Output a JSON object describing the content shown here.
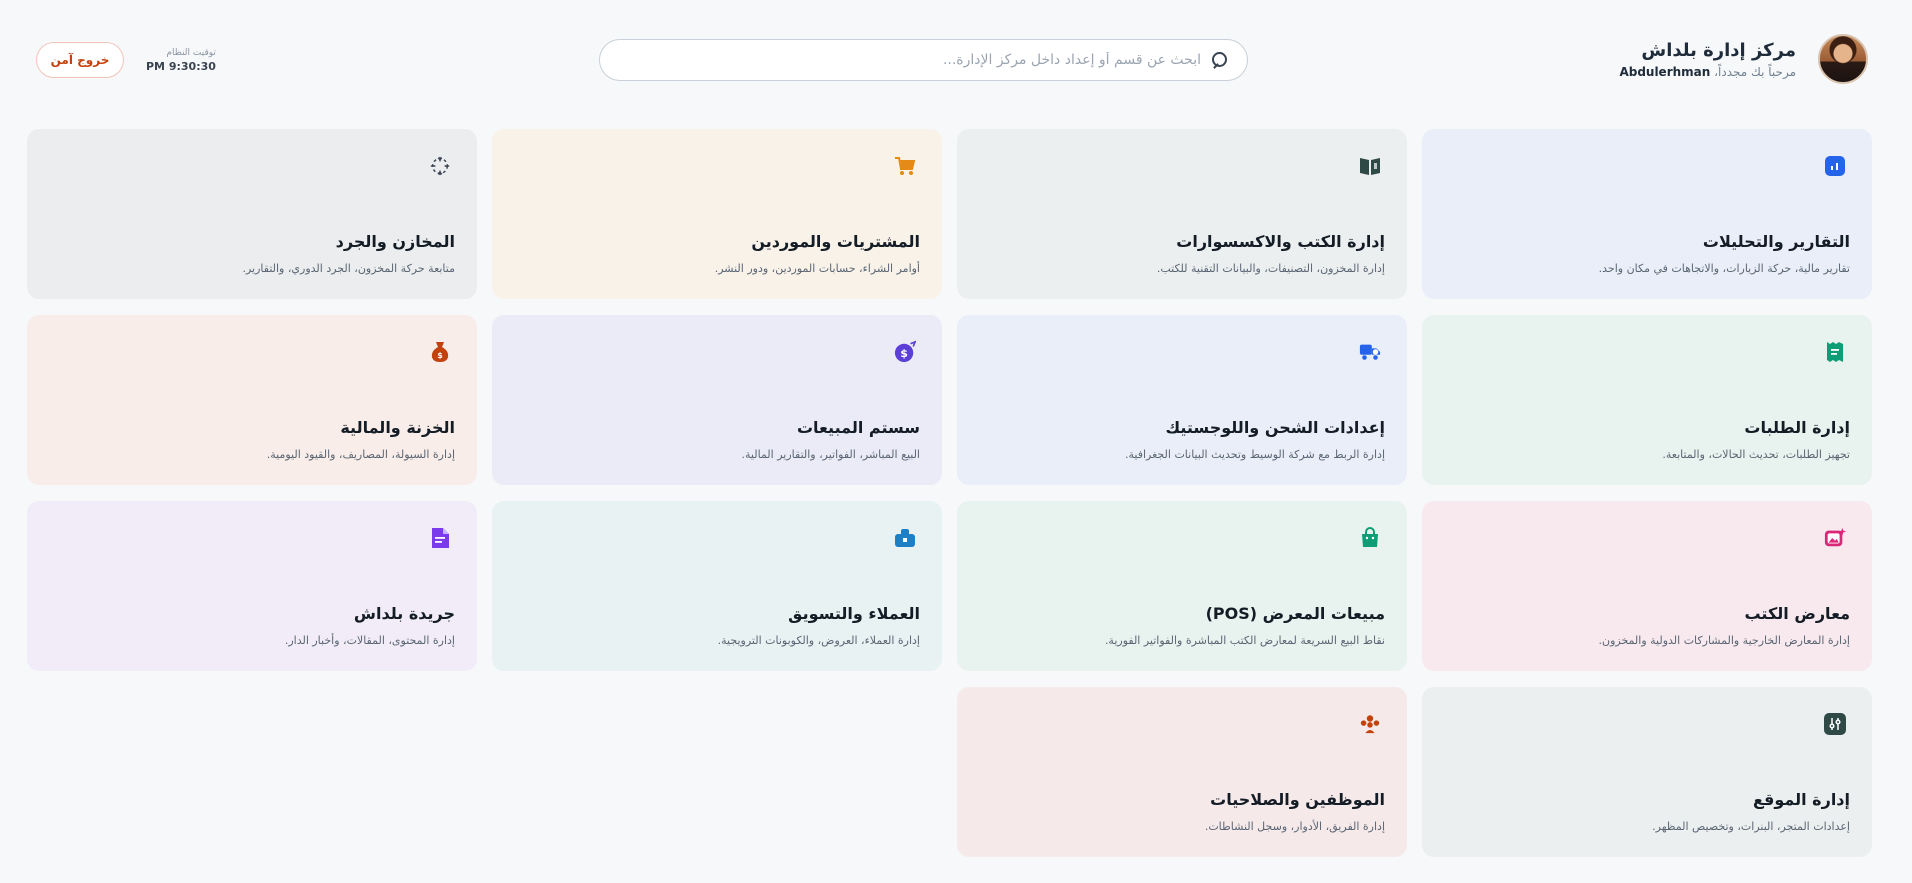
{
  "header": {
    "title": "مركز إدارة بلداش",
    "welcome": "مرحباً بك مجدداً،",
    "username": "Abdulerhman",
    "search_placeholder": "ابحث عن قسم أو إعداد داخل مركز الإدارة...",
    "clock_label": "توقيت النظام",
    "clock_time": "PM 9:30:30",
    "logout_label": "خروج آمن"
  },
  "colors": {
    "accent_logout": "#c2410c"
  },
  "cards": [
    {
      "title": "التقارير والتحليلات",
      "desc": "تقارير مالية، حركة الزيارات، والاتجاهات في مكان واحد.",
      "icon": "chart-icon",
      "bg": "#e9eef8",
      "color": "#2563eb"
    },
    {
      "title": "إدارة الكتب والاكسسوارات",
      "desc": "إدارة المخزون، التصنيفات، والبيانات التقنية للكتب.",
      "icon": "book-icon",
      "bg": "#eceff0",
      "color": "#2f4a46"
    },
    {
      "title": "المشتريات والموردين",
      "desc": "أوامر الشراء، حسابات الموردين، ودور النشر.",
      "icon": "cart-icon",
      "bg": "#f8f2e9",
      "color": "#e58a16"
    },
    {
      "title": "المخازن والجرد",
      "desc": "متابعة حركة المخزون، الجرد الدوري، والتقارير.",
      "icon": "scan-icon",
      "bg": "#ebedee",
      "color": "#3a4451"
    },
    {
      "title": "إدارة الطلبات",
      "desc": "تجهيز الطلبات، تحديث الحالات، والمتابعة.",
      "icon": "receipt-icon",
      "bg": "#e8f2ee",
      "color": "#0f9d76"
    },
    {
      "title": "إعدادات الشحن واللوجستيك",
      "desc": "إدارة الربط مع شركة الوسيط وتحديث البيانات الجغرافية.",
      "icon": "truck-icon",
      "bg": "#e9eef8",
      "color": "#2563eb"
    },
    {
      "title": "سستم المبيعات",
      "desc": "البيع المباشر، الفواتير، والتقارير المالية.",
      "icon": "dollar-icon",
      "bg": "#ebebf7",
      "color": "#5b3fd6"
    },
    {
      "title": "الخزنة والمالية",
      "desc": "إدارة السيولة، المصاريف، والقيود اليومية.",
      "icon": "money-bag-icon",
      "bg": "#f8ede8",
      "color": "#c2410c"
    },
    {
      "title": "معارض الكتب",
      "desc": "إدارة المعارض الخارجية والمشاركات الدولية والمخزون.",
      "icon": "image-star-icon",
      "bg": "#f7e9ee",
      "color": "#db2777"
    },
    {
      "title": "مبيعات المعرض (POS)",
      "desc": "نقاط البيع السريعة لمعارض الكتب المباشرة والفواتير الفورية.",
      "icon": "shopping-bag-icon",
      "bg": "#e8f2ee",
      "color": "#0f9d76"
    },
    {
      "title": "العملاء والتسويق",
      "desc": "إدارة العملاء، العروض، والكوبونات الترويجية.",
      "icon": "megaphone-icon",
      "bg": "#e8f2f3",
      "color": "#1f7fc4"
    },
    {
      "title": "جريدة بلداش",
      "desc": "إدارة المحتوى، المقالات، وأخبار الدار.",
      "icon": "newspaper-icon",
      "bg": "#f1ecf8",
      "color": "#7c3aed"
    },
    {
      "title": "إدارة الموقع",
      "desc": "إعدادات المتجر، البنرات، وتخصيص المظهر.",
      "icon": "sliders-icon",
      "bg": "#eceff0",
      "color": "#2f4a46"
    },
    {
      "title": "الموظفين والصلاحيات",
      "desc": "إدارة الفريق، الأدوار، وسجل النشاطات.",
      "icon": "team-icon",
      "bg": "#f6e9ea",
      "color": "#c2410c"
    }
  ]
}
